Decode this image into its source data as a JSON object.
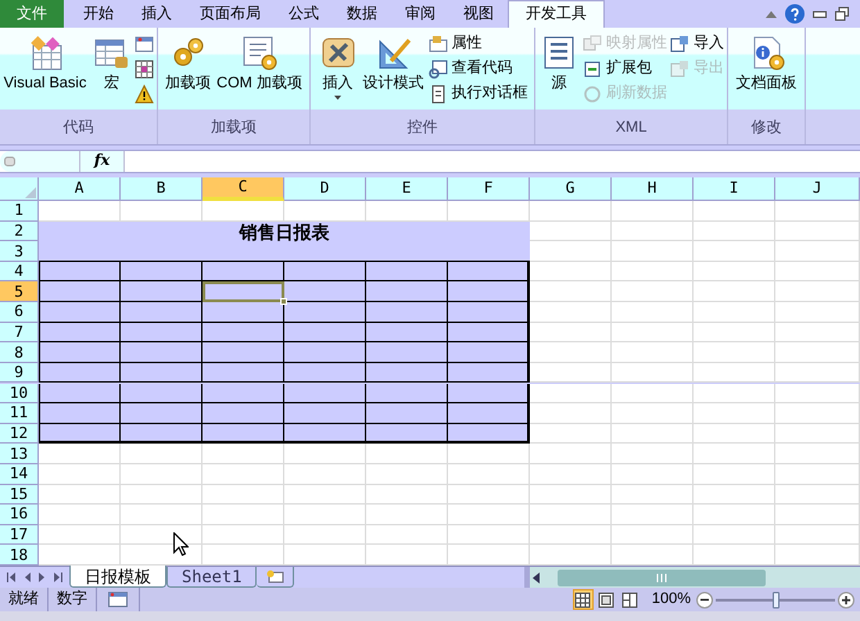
{
  "ribbon_tabs": [
    {
      "label": "文件",
      "kind": "file",
      "selected": false
    },
    {
      "label": "开始",
      "kind": "tab",
      "selected": false
    },
    {
      "label": "插入",
      "kind": "tab",
      "selected": false
    },
    {
      "label": "页面布局",
      "kind": "tab",
      "selected": false
    },
    {
      "label": "公式",
      "kind": "tab",
      "selected": false
    },
    {
      "label": "数据",
      "kind": "tab",
      "selected": false
    },
    {
      "label": "审阅",
      "kind": "tab",
      "selected": false
    },
    {
      "label": "视图",
      "kind": "tab",
      "selected": false
    },
    {
      "label": "开发工具",
      "kind": "tab",
      "selected": true
    }
  ],
  "ribbon_groups": [
    {
      "label": "代码",
      "items": [
        {
          "kind": "large",
          "label": "Visual Basic",
          "dropdown": false
        },
        {
          "kind": "large",
          "label": "宏",
          "dropdown": false
        },
        {
          "kind": "stack",
          "items": [
            {
              "disabled": false
            },
            {
              "disabled": false
            },
            {
              "disabled": false
            }
          ]
        }
      ]
    },
    {
      "label": "加载项",
      "items": [
        {
          "kind": "large",
          "label": "加载项",
          "dropdown": false
        },
        {
          "kind": "large",
          "label": "COM 加载项",
          "dropdown": false
        }
      ]
    },
    {
      "label": "控件",
      "items": [
        {
          "kind": "large",
          "label": "插入",
          "dropdown": true
        },
        {
          "kind": "large",
          "label": "设计模式",
          "dropdown": false
        },
        {
          "kind": "stack",
          "items": [
            {
              "label": "属性",
              "disabled": false
            },
            {
              "label": "查看代码",
              "disabled": false
            },
            {
              "label": "执行对话框",
              "disabled": false
            }
          ]
        }
      ]
    },
    {
      "label": "XML",
      "items": [
        {
          "kind": "large",
          "label": "源",
          "dropdown": false
        },
        {
          "kind": "stack",
          "items": [
            {
              "label": "映射属性",
              "disabled": true
            },
            {
              "label": "扩展包",
              "disabled": false
            },
            {
              "label": "刷新数据",
              "disabled": true
            }
          ]
        },
        {
          "kind": "stack",
          "items": [
            {
              "label": "导入",
              "disabled": false
            },
            {
              "label": "导出",
              "disabled": true
            }
          ]
        }
      ]
    },
    {
      "label": "修改",
      "items": [
        {
          "kind": "large",
          "label": "文档面板",
          "dropdown": false
        }
      ]
    }
  ],
  "formula_bar": {
    "function_label": "fx"
  },
  "sheet": {
    "columns": [
      {
        "label": "A",
        "selected": false
      },
      {
        "label": "B",
        "selected": false
      },
      {
        "label": "C",
        "selected": true
      },
      {
        "label": "D",
        "selected": false
      },
      {
        "label": "E",
        "selected": false
      },
      {
        "label": "F",
        "selected": false
      },
      {
        "label": "G",
        "selected": false
      },
      {
        "label": "H",
        "selected": false
      },
      {
        "label": "I",
        "selected": false
      },
      {
        "label": "J",
        "selected": false
      }
    ],
    "rows": [
      {
        "label": "1",
        "selected": false
      },
      {
        "label": "2",
        "selected": false
      },
      {
        "label": "3",
        "selected": false
      },
      {
        "label": "4",
        "selected": false
      },
      {
        "label": "5",
        "selected": true
      },
      {
        "label": "6",
        "selected": false
      },
      {
        "label": "7",
        "selected": false
      },
      {
        "label": "8",
        "selected": false
      },
      {
        "label": "9",
        "selected": false
      },
      {
        "label": "10",
        "selected": false
      },
      {
        "label": "11",
        "selected": false
      },
      {
        "label": "12",
        "selected": false
      },
      {
        "label": "13",
        "selected": false
      },
      {
        "label": "14",
        "selected": false
      },
      {
        "label": "15",
        "selected": false
      },
      {
        "label": "16",
        "selected": false
      },
      {
        "label": "17",
        "selected": false
      },
      {
        "label": "18",
        "selected": false
      }
    ],
    "title": "销售日报表",
    "table_rows": [
      {
        "cells": [
          {
            "selected": false
          },
          {
            "selected": false
          },
          {
            "selected": false
          },
          {
            "selected": false
          },
          {
            "selected": false
          },
          {
            "selected": false
          }
        ]
      },
      {
        "cells": [
          {
            "selected": false
          },
          {
            "selected": false
          },
          {
            "selected": true
          },
          {
            "selected": false
          },
          {
            "selected": false
          },
          {
            "selected": false
          }
        ]
      },
      {
        "cells": [
          {
            "selected": false
          },
          {
            "selected": false
          },
          {
            "selected": false
          },
          {
            "selected": false
          },
          {
            "selected": false
          },
          {
            "selected": false
          }
        ]
      },
      {
        "cells": [
          {
            "selected": false
          },
          {
            "selected": false
          },
          {
            "selected": false
          },
          {
            "selected": false
          },
          {
            "selected": false
          },
          {
            "selected": false
          }
        ]
      },
      {
        "cells": [
          {
            "selected": false
          },
          {
            "selected": false
          },
          {
            "selected": false
          },
          {
            "selected": false
          },
          {
            "selected": false
          },
          {
            "selected": false
          }
        ]
      },
      {
        "cells": [
          {
            "selected": false
          },
          {
            "selected": false
          },
          {
            "selected": false
          },
          {
            "selected": false
          },
          {
            "selected": false
          },
          {
            "selected": false
          }
        ]
      },
      {
        "cells": [
          {
            "selected": false
          },
          {
            "selected": false
          },
          {
            "selected": false
          },
          {
            "selected": false
          },
          {
            "selected": false
          },
          {
            "selected": false
          }
        ]
      },
      {
        "cells": [
          {
            "selected": false
          },
          {
            "selected": false
          },
          {
            "selected": false
          },
          {
            "selected": false
          },
          {
            "selected": false
          },
          {
            "selected": false
          }
        ]
      },
      {
        "cells": [
          {
            "selected": false
          },
          {
            "selected": false
          },
          {
            "selected": false
          },
          {
            "selected": false
          },
          {
            "selected": false
          },
          {
            "selected": false
          }
        ]
      }
    ]
  },
  "sheet_tabs": [
    {
      "label": "日报模板",
      "selected": true
    },
    {
      "label": "Sheet1",
      "selected": false
    }
  ],
  "status_bar": {
    "items": [
      "就绪",
      "数字"
    ],
    "views": [
      {
        "selected": true
      },
      {
        "selected": false
      },
      {
        "selected": false
      }
    ],
    "zoom": {
      "reading": "100%",
      "level": 0.5
    }
  }
}
